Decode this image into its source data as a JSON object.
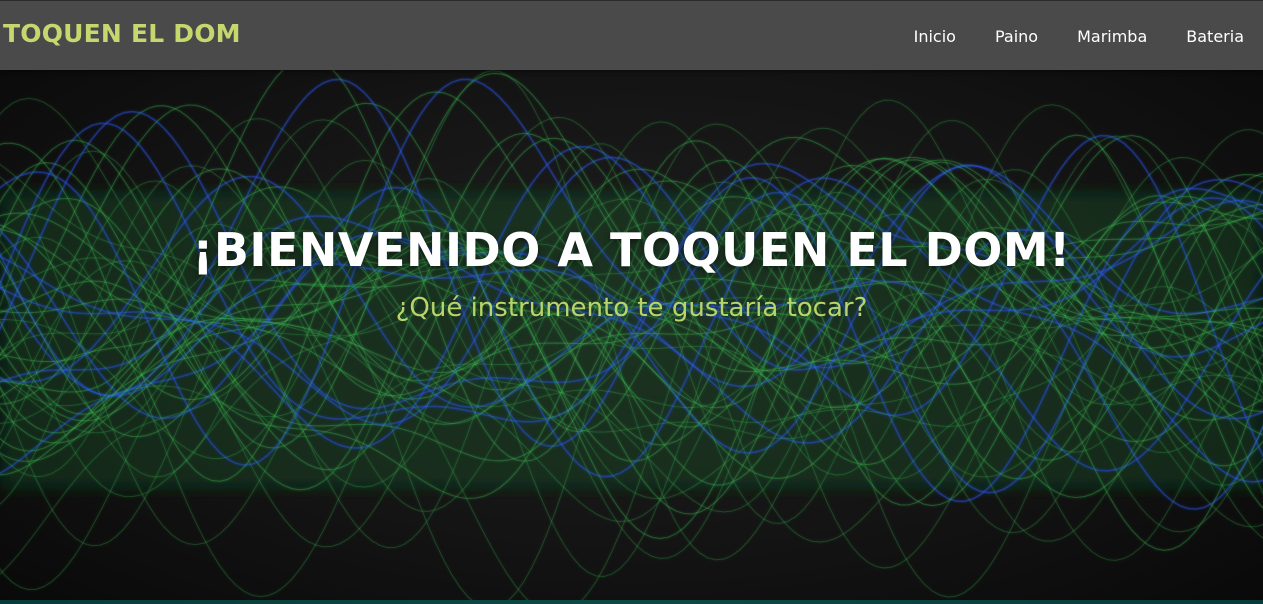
{
  "header": {
    "brand": "TOQUEN EL DOM",
    "nav": [
      {
        "label": "Inicio"
      },
      {
        "label": "Paino"
      },
      {
        "label": "Marimba"
      },
      {
        "label": "Bateria"
      }
    ]
  },
  "hero": {
    "title": "¡BIENVENIDO A TOQUEN EL DOM!",
    "subtitle": "¿Qué instrumento te gustaría tocar?",
    "background_image": "green-blue-sound-wave"
  },
  "colors": {
    "navbar_bg": "#4a4a4a",
    "brand": "#c5d86d",
    "nav_text": "#ffffff",
    "title": "#ffffff",
    "subtitle": "#b9d46a",
    "wave_green": "#3fd25a",
    "wave_blue": "#2a5bff"
  }
}
